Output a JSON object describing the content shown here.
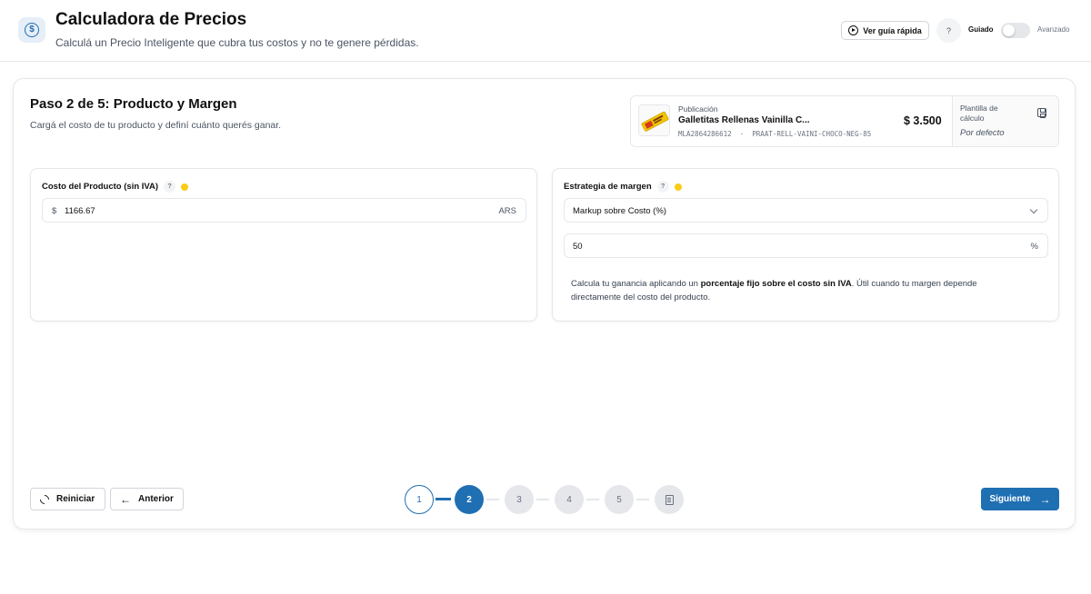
{
  "header": {
    "title": "Calculadora de Precios",
    "subtitle": "Calculá un Precio Inteligente que cubra tus costos y no te genere pérdidas.",
    "icon": "dollar-coin-icon",
    "guide_button": "Ver guía rápida",
    "help": "?",
    "mode_guided": "Guiado",
    "mode_advanced": "Avanzado",
    "mode_toggle_on": false
  },
  "step": {
    "title": "Paso 2 de 5: Producto y Margen",
    "subtitle": "Cargá el costo de tu producto y definí cuánto querés ganar."
  },
  "publication": {
    "label": "Publicación",
    "name": "Galletitas Rellenas Vainilla C...",
    "id": "MLA2864286612",
    "separator": "·",
    "sku": "PRAAT-RELL-VAINI-CHOCO-NEG-85",
    "price": "$ 3.500",
    "template_label": "Plantilla de cálculo",
    "template_value": "Por defecto"
  },
  "cost_panel": {
    "label": "Costo del Producto (sin IVA)",
    "help": "?",
    "prefix": "$",
    "value": "1166.67",
    "currency": "ARS"
  },
  "margin_panel": {
    "label": "Estrategia de margen",
    "help": "?",
    "strategy": "Markup sobre Costo (%)",
    "value": "50",
    "unit": "%",
    "desc_before": "Calcula tu ganancia aplicando un ",
    "desc_bold": "porcentaje fijo sobre el costo sin IVA",
    "desc_after": ". Útil cuando tu margen depende directamente del costo del producto."
  },
  "footer": {
    "reset": "Reiniciar",
    "prev": "Anterior",
    "next": "Siguiente",
    "steps": [
      "1",
      "2",
      "3",
      "4",
      "5"
    ],
    "current_step": 2
  },
  "colors": {
    "primary": "#1f6fb3",
    "indicator": "#facc15"
  }
}
